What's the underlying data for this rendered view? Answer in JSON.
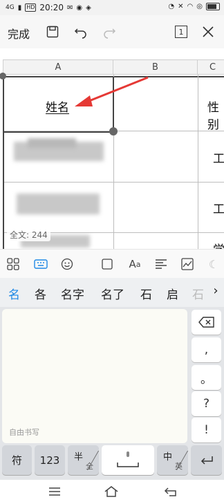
{
  "status_bar": {
    "signal_text": "4G",
    "hd": "HD",
    "time": "20:20"
  },
  "toolbar": {
    "done_label": "完成",
    "tab_count": "1"
  },
  "sheet": {
    "columns": [
      "A",
      "B",
      "C"
    ],
    "cell_a1": "姓名",
    "cell_c1": "性别",
    "c2_partial": "工",
    "c3_partial": "工",
    "c4_partial": "学",
    "word_count": "全文: 244"
  },
  "candidates": [
    "名",
    "各",
    "名字",
    "名了",
    "石",
    "启",
    "石"
  ],
  "keyboard": {
    "handwriting_label": "自由书写",
    "punct": [
      ",",
      "。",
      "?",
      "!"
    ],
    "key_symbol": "符",
    "key_123": "123",
    "half_top": "半",
    "half_bottom": "全",
    "lang_top": "中",
    "lang_bottom": "英"
  },
  "colors": {
    "arrow": "#e53935",
    "accent_blue": "#1e88e5"
  }
}
